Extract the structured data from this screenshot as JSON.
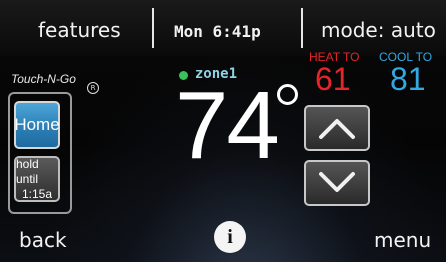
{
  "topbar": {
    "features_label": "features",
    "datetime": "Mon 6:41p",
    "mode_label": "mode: auto"
  },
  "setpoints": {
    "heat_label": "HEAT TO",
    "heat_value": "61",
    "cool_label": "COOL TO",
    "cool_value": "81"
  },
  "zone": {
    "name": "zone1",
    "status_color": "#39c25a"
  },
  "brand": {
    "name": "Touch-N-Go",
    "registered": "R"
  },
  "left_panel": {
    "home_label": "Home",
    "hold_line1": "hold until",
    "hold_line2": "1:15a"
  },
  "temperature": {
    "value": "74",
    "unit_icon": "degree-symbol"
  },
  "controls": {
    "up_icon": "chevron-up-icon",
    "down_icon": "chevron-down-icon"
  },
  "bottom": {
    "back_label": "back",
    "info_label": "i",
    "menu_label": "menu"
  },
  "colors": {
    "heat": "#e8232a",
    "cool": "#33a9e0",
    "home_button": "#2c7fb5",
    "zone_text": "#8fd4e3"
  }
}
